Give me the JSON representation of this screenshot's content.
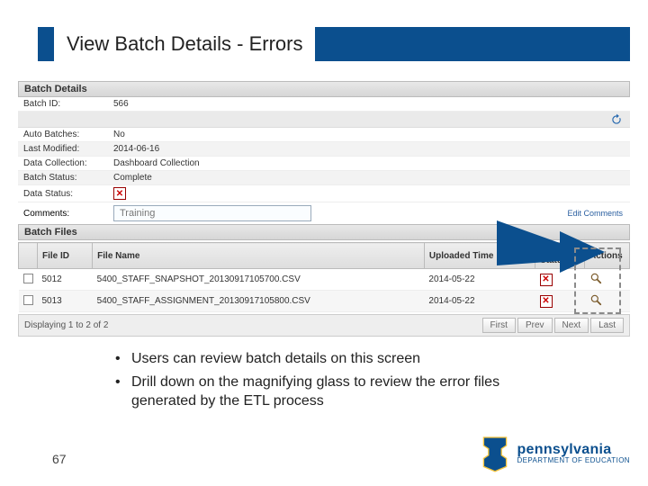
{
  "slide": {
    "title": "View Batch Details - Errors",
    "page_number": "67"
  },
  "bullets": [
    "Users can review batch details on this screen",
    "Drill down on the magnifying glass to review the error files generated by the ETL process"
  ],
  "batch_details": {
    "heading": "Batch Details",
    "rows": {
      "batch_id_label": "Batch ID:",
      "batch_id_value": "566",
      "auto_batches_label": "Auto Batches:",
      "auto_batches_value": "No",
      "last_modified_label": "Last Modified:",
      "last_modified_value": "2014-06-16",
      "data_collection_label": "Data Collection:",
      "data_collection_value": "Dashboard Collection",
      "batch_status_label": "Batch Status:",
      "batch_status_value": "Complete",
      "data_status_label": "Data Status:",
      "comments_label": "Comments:",
      "comments_value": "Training"
    },
    "edit_comments": "Edit Comments"
  },
  "batch_files": {
    "heading": "Batch Files",
    "columns": {
      "file_id": "File ID",
      "file_name": "File Name",
      "uploaded_time": "Uploaded Time",
      "data_status": "Data Status",
      "actions": "Actions"
    },
    "rows": [
      {
        "file_id": "5012",
        "file_name": "5400_STAFF_SNAPSHOT_20130917105700.CSV",
        "uploaded_time": "2014-05-22"
      },
      {
        "file_id": "5013",
        "file_name": "5400_STAFF_ASSIGNMENT_20130917105800.CSV",
        "uploaded_time": "2014-05-22"
      }
    ]
  },
  "pager": {
    "summary": "Displaying 1 to 2 of 2",
    "first": "First",
    "prev": "Prev",
    "next": "Next",
    "last": "Last"
  },
  "logo": {
    "line1": "pennsylvania",
    "line2": "DEPARTMENT OF EDUCATION"
  }
}
